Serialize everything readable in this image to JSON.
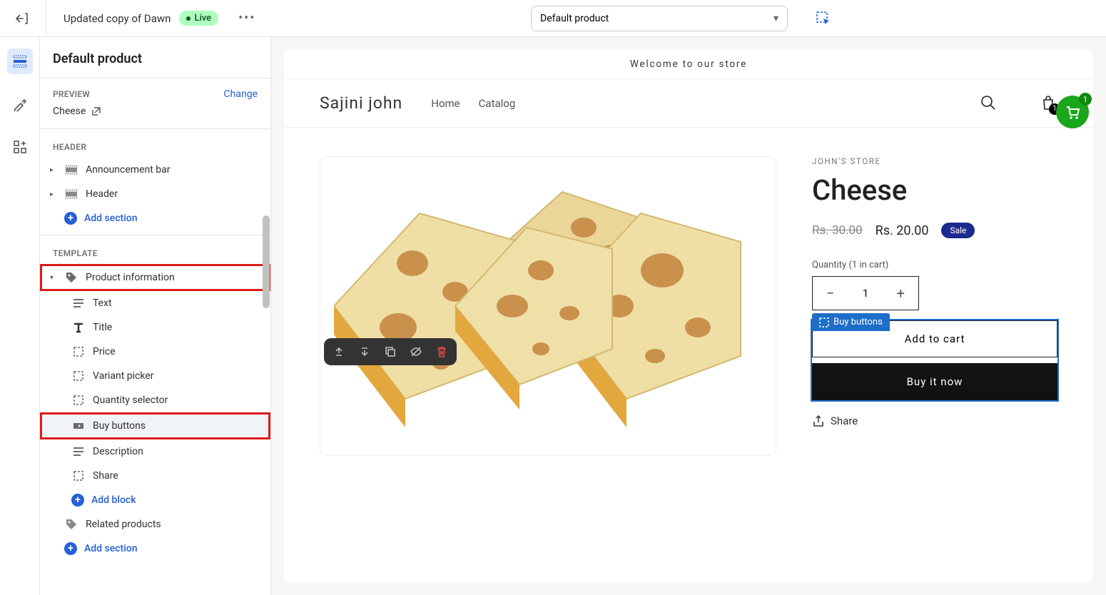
{
  "topbar": {
    "theme_name": "Updated copy of Dawn",
    "live_label": "Live",
    "page_select": "Default product"
  },
  "sidebar": {
    "title": "Default product",
    "preview_label": "PREVIEW",
    "change_label": "Change",
    "preview_value": "Cheese",
    "header_label": "HEADER",
    "header_items": [
      {
        "label": "Announcement bar"
      },
      {
        "label": "Header"
      }
    ],
    "add_section": "Add section",
    "template_label": "TEMPLATE",
    "product_info": "Product information",
    "blocks": [
      "Text",
      "Title",
      "Price",
      "Variant picker",
      "Quantity selector",
      "Buy buttons",
      "Description",
      "Share"
    ],
    "add_block": "Add block",
    "related_products": "Related products"
  },
  "store": {
    "announcement": "Welcome to our store",
    "name": "Sajini john",
    "nav": [
      "Home",
      "Catalog"
    ],
    "cart_count": "1",
    "vendor": "JOHN'S STORE",
    "product_title": "Cheese",
    "price_old": "Rs. 30.00",
    "price_new": "Rs. 20.00",
    "sale": "Sale",
    "qty_label": "Quantity (1 in cart)",
    "qty_value": "1",
    "add_cart": "Add to cart",
    "buy_now": "Buy it now",
    "share": "Share",
    "buy_label": "Buy buttons",
    "float_badge": "1"
  }
}
